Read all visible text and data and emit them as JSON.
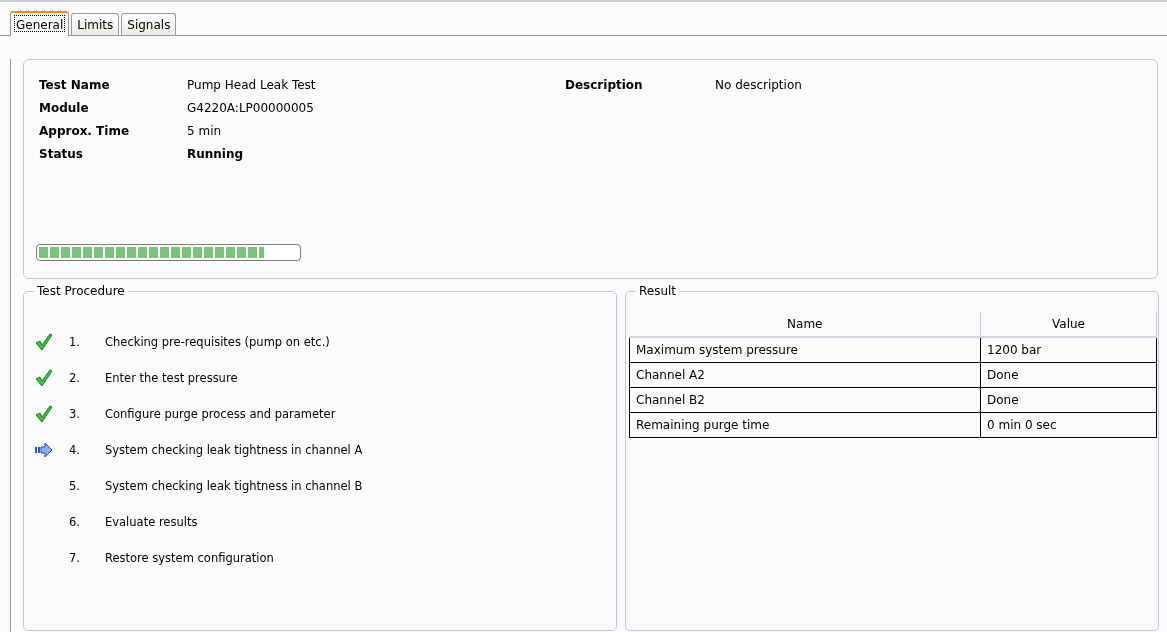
{
  "tabs": [
    {
      "label": "General",
      "selected": true
    },
    {
      "label": "Limits",
      "selected": false
    },
    {
      "label": "Signals",
      "selected": false
    }
  ],
  "general": {
    "fields": [
      {
        "label": "Test Name",
        "value": "Pump Head Leak Test",
        "bold": false
      },
      {
        "label": "Module",
        "value": "G4220A:LP00000005",
        "bold": false
      },
      {
        "label": "Approx. Time",
        "value": "5 min",
        "bold": false
      },
      {
        "label": "Status",
        "value": "Running",
        "bold": true
      }
    ],
    "description": {
      "label": "Description",
      "value": "No description"
    },
    "progress": {
      "level": 0.87
    }
  },
  "test_procedure": {
    "title": "Test Procedure",
    "steps": [
      {
        "number": "1.",
        "text": "Checking pre-requisites (pump on etc.)",
        "kind": "done"
      },
      {
        "number": "2.",
        "text": "Enter the test pressure",
        "kind": "done"
      },
      {
        "number": "3.",
        "text": "Configure purge process and parameter",
        "kind": "done"
      },
      {
        "number": "4.",
        "text": "System checking leak tightness in channel A",
        "kind": "current"
      },
      {
        "number": "5.",
        "text": "System checking leak tightness in channel B",
        "kind": "pending"
      },
      {
        "number": "6.",
        "text": "Evaluate results",
        "kind": "pending"
      },
      {
        "number": "7.",
        "text": "Restore system configuration",
        "kind": "pending"
      }
    ]
  },
  "result": {
    "title": "Result",
    "columns": [
      "Name",
      "Value"
    ],
    "rows": [
      [
        "Maximum system pressure",
        "1200 bar"
      ],
      [
        "Channel A2",
        "Done"
      ],
      [
        "Channel B2",
        "Done"
      ],
      [
        "Remaining purge time",
        "0 min 0 sec"
      ]
    ]
  }
}
